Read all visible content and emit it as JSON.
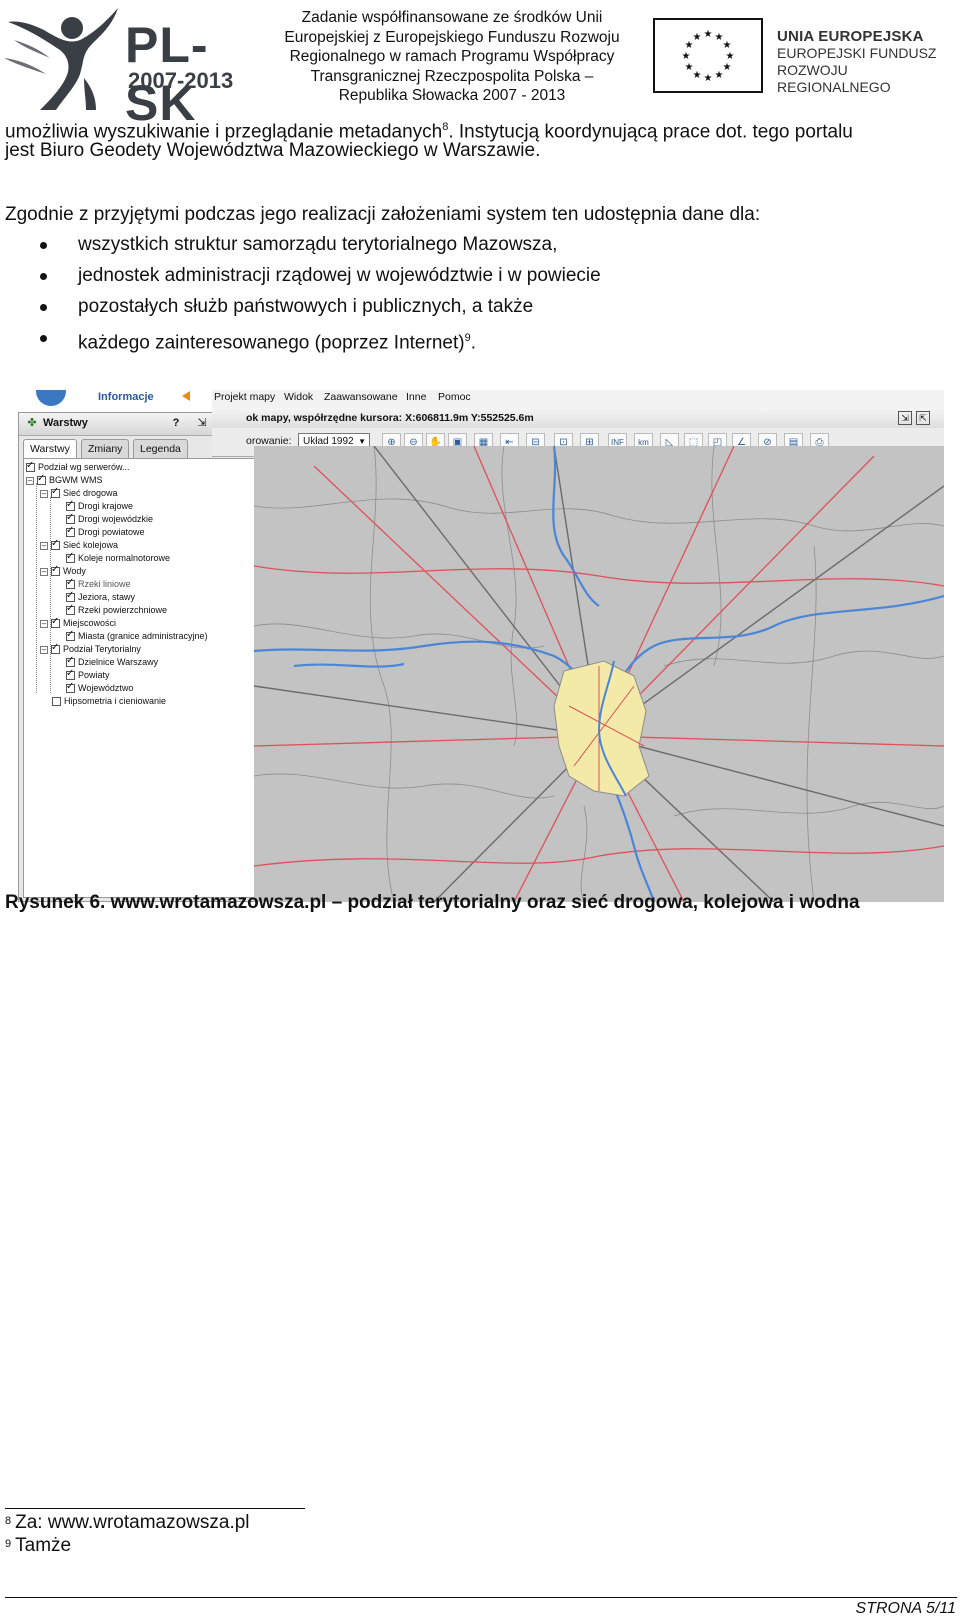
{
  "header": {
    "logo_title": "PL-SK",
    "logo_years": "2007-2013",
    "cofinance_lines": [
      "Zadanie współfinansowane ze środków Unii",
      "Europejskiej z Europejskiego Funduszu Rozwoju",
      "Regionalnego w ramach Programu Współpracy",
      "Transgranicznej Rzeczpospolita Polska –",
      "Republika Słowacka 2007 - 2013"
    ],
    "eu_title": "UNIA EUROPEJSKA",
    "eu_sub1": "EUROPEJSKI FUNDUSZ",
    "eu_sub2": "ROZWOJU REGIONALNEGO"
  },
  "body": {
    "p1_line1_a": "umożliwia wyszukiwanie i przeglądanie metadanych",
    "p1_sup": "8",
    "p1_line1_b": ". Instytucją koordynującą prace dot. tego portalu",
    "p1_line2": "jest Biuro Geodety Województwa Mazowieckiego w Warszawie.",
    "p2": "Zgodnie z przyjętymi podczas jego realizacji założeniami system ten udostępnia dane dla:",
    "bullets": [
      "wszystkich struktur samorządu terytorialnego Mazowsza,",
      "jednostek administracji rządowej w województwie i w powiecie",
      "pozostałych służb państwowych i publicznych, a także",
      "każdego zainteresowanego (poprzez Internet)"
    ],
    "bullet4_sup": "9",
    "bullet4_end": "."
  },
  "figure": {
    "info_label": "Informacje",
    "panel_title": "Warstwy",
    "panel_help": "?",
    "tabs": [
      "Warstwy",
      "Zmiany",
      "Legenda"
    ],
    "layers": [
      "Podział wg serwerów...",
      "BGWM WMS",
      "Sieć drogowa",
      "Drogi krajowe",
      "Drogi wojewódzkie",
      "Drogi powiatowe",
      "Sieć kolejowa",
      "Koleje normalnotorowe",
      "Wody",
      "Rzeki liniowe",
      "Jeziora, stawy",
      "Rzeki powierzchniowe",
      "Miejscowości",
      "Miasta (granice administracyjne)",
      "Podział Terytorialny",
      "Dzielnice Warszawy",
      "Powiaty",
      "Województwo",
      "Hipsometria i cieniowanie"
    ],
    "menu": [
      "Projekt mapy",
      "Widok",
      "Zaawansowane",
      "Inne",
      "Pomoc"
    ],
    "status_text": "ok mapy, współrzędne kursora: X:606811.9m Y:552525.6m",
    "coord_label": "orowanie:",
    "coord_system": "Układ 1992",
    "tool_inf": "INF",
    "tool_km": "km"
  },
  "caption": "Rysunek 6. www.wrotamazowsza.pl – podział terytorialny oraz sieć drogowa, kolejowa i wodna",
  "footnotes": [
    {
      "num": "8",
      "text": "Za: www.wrotamazowsza.pl"
    },
    {
      "num": "9",
      "text": "Tamże"
    }
  ],
  "page_number": "STRONA 5/11",
  "colors": {
    "eu_blue": "#1f3f8f",
    "eu_star": "#111111",
    "map_bg": "#c3c3c3",
    "road_red": "#e0505a",
    "river_blue": "#4a86d8",
    "warsaw_fill": "#f3eaa8"
  }
}
